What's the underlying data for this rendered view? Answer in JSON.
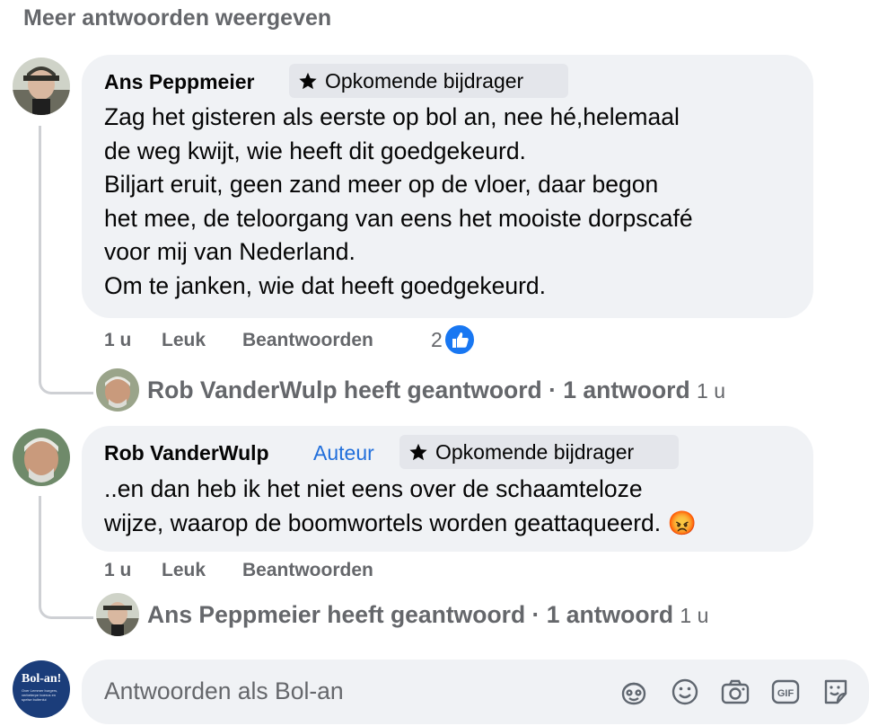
{
  "show_more": "Meer antwoorden weergeven",
  "comment1": {
    "author": "Ans Peppmeier",
    "badge": "Opkomende bijdrager",
    "text": "Zag het gisteren als eerste op bol an, nee hé,helemaal\nde weg kwijt, wie heeft dit goedgekeurd.\nBiljart eruit, geen zand meer op de vloer, daar begon\nhet mee, de teloorgang van eens het mooiste dorpscafé\nvoor mij van Nederland.\nOm te janken, wie dat heeft goedgekeurd.",
    "time": "1 u",
    "like": "Leuk",
    "reply": "Beantwoorden",
    "reaction_count": "2",
    "reaction_color": "#1877f2",
    "reply_summary": {
      "name_text": "Rob VanderWulp heeft geantwoord",
      "count_text": "· 1 antwoord",
      "time": "1 u"
    }
  },
  "comment2": {
    "author": "Rob VanderWulp",
    "author_label": "Auteur",
    "badge": "Opkomende bijdrager",
    "text": "..en dan heb ik het niet eens over de schaamteloze\nwijze, waarop de boomwortels worden geattaqueerd.",
    "emoji": "😡",
    "time": "1 u",
    "like": "Leuk",
    "reply": "Beantwoorden",
    "reply_summary": {
      "name_text": "Ans Peppmeier heeft geantwoord",
      "count_text": "· 1 antwoord",
      "time": "1 u"
    }
  },
  "composer": {
    "avatar_text": "Bol-an!",
    "avatar_subtext": "Over Lemmer burgers, verbeterpe boerus en spelse buitenlui",
    "placeholder": "Antwoorden als Bol-an",
    "icons": [
      "avatar-sticker-icon",
      "emoji-icon",
      "camera-icon",
      "gif-icon",
      "sticker-icon"
    ]
  }
}
